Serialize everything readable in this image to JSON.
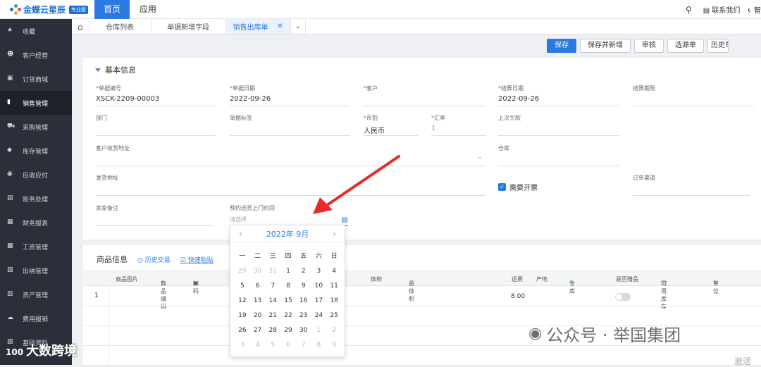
{
  "brand": {
    "name": "金蝶云星辰",
    "badge": "专业版"
  },
  "nav": {
    "home": "首页",
    "app": "应用"
  },
  "topright": {
    "contact": "联系我们",
    "cut": "智"
  },
  "sidebar": {
    "items": [
      {
        "label": "收藏",
        "icon": "star-icon"
      },
      {
        "label": "客户经营",
        "icon": "user-icon"
      },
      {
        "label": "订货商城",
        "icon": "shop-icon"
      },
      {
        "label": "销售管理",
        "icon": "bar-chart-icon",
        "active": true
      },
      {
        "label": "采购管理",
        "icon": "cart-icon"
      },
      {
        "label": "库存管理",
        "icon": "box-icon"
      },
      {
        "label": "应收应付",
        "icon": "money-icon"
      },
      {
        "label": "账务处理",
        "icon": "ledger-icon"
      },
      {
        "label": "财务报表",
        "icon": "report-icon"
      },
      {
        "label": "工资管理",
        "icon": "wallet-icon"
      },
      {
        "label": "出纳管理",
        "icon": "cashier-icon"
      },
      {
        "label": "资产管理",
        "icon": "asset-icon"
      },
      {
        "label": "费用报销",
        "icon": "expense-icon"
      },
      {
        "label": "基础资料",
        "icon": "base-icon"
      }
    ]
  },
  "tabs": [
    {
      "label": "仓库列表"
    },
    {
      "label": "单据新增字段"
    },
    {
      "label": "销售出库单",
      "active": true
    }
  ],
  "toolbar": {
    "save": "保存",
    "save_new": "保存并新增",
    "audit": "审核",
    "select_bill": "选源单",
    "history": "历史单"
  },
  "section": {
    "title": "基本信息"
  },
  "fields": {
    "bill_no": {
      "label": "单据编号",
      "value": "XSCK-2209-00003"
    },
    "bill_date": {
      "label": "单据日期",
      "value": "2022-09-26"
    },
    "customer": {
      "label": "客户",
      "value": ""
    },
    "settle_date": {
      "label": "结算日期",
      "value": "2022-09-26"
    },
    "settle_period": {
      "label": "结算期限",
      "value": ""
    },
    "dept": {
      "label": "部门",
      "value": ""
    },
    "bill_tag": {
      "label": "单据标签",
      "value": ""
    },
    "currency": {
      "label": "币别",
      "value": "人民币"
    },
    "rate": {
      "label": "汇率",
      "value": "1"
    },
    "last_debt": {
      "label": "上次欠款",
      "value": ""
    },
    "ship_addr": {
      "label": "客户收货地址",
      "value": ""
    },
    "warehouse": {
      "label": "仓库",
      "value": ""
    },
    "deliver_addr": {
      "label": "发货地址",
      "value": ""
    },
    "need_invoice": {
      "label": "需要开票",
      "checked": true
    },
    "order_channel": {
      "label": "订单渠道",
      "value": ""
    },
    "seller_note": {
      "label": "卖家备注",
      "value": ""
    },
    "appointment": {
      "label": "预约送货上门时间",
      "placeholder": "请选择"
    }
  },
  "goods": {
    "title": "商品信息",
    "history_link": "历史交易",
    "paste_link": "快速粘贴",
    "columns": [
      "商品图片",
      "商品编码",
      "扫码",
      "体积",
      "总体积",
      "运费",
      "产地",
      "仓库",
      "是否赠品",
      "可用库存",
      "单位"
    ],
    "rows": [
      {
        "no": "1",
        "freight": "8.00"
      }
    ]
  },
  "calendar": {
    "title": "2022年 9月",
    "weekdays": [
      "一",
      "二",
      "三",
      "四",
      "五",
      "六",
      "日"
    ],
    "days": [
      [
        "29",
        "30",
        "31",
        "1",
        "2",
        "3",
        "4"
      ],
      [
        "5",
        "6",
        "7",
        "8",
        "9",
        "10",
        "11"
      ],
      [
        "12",
        "13",
        "14",
        "15",
        "16",
        "17",
        "18"
      ],
      [
        "19",
        "20",
        "21",
        "22",
        "23",
        "24",
        "25"
      ],
      [
        "26",
        "27",
        "28",
        "29",
        "30",
        "1",
        "2"
      ],
      [
        "3",
        "4",
        "5",
        "6",
        "7",
        "8",
        "9"
      ]
    ],
    "dim_first_row": 3,
    "dim_last_rows_from": 5
  },
  "watermark": {
    "wechat": "公众号 · 举国集团",
    "corner": "大数跨境",
    "corner_logo": "100"
  },
  "cut_text": "激活"
}
